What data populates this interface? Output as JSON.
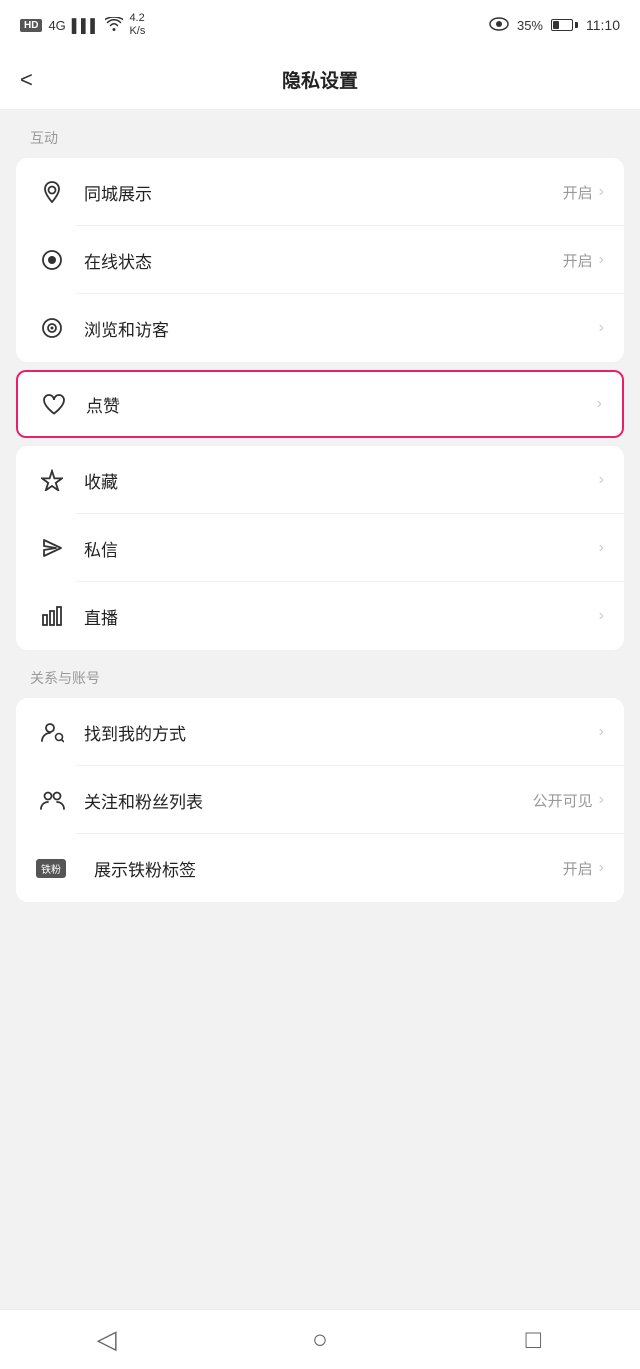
{
  "statusBar": {
    "hd": "HD",
    "signal": "4G",
    "network": "4.2\nK/s",
    "battery": "35%",
    "time": "11:10"
  },
  "header": {
    "back": "<",
    "title": "隐私设置"
  },
  "sections": [
    {
      "label": "互动",
      "items": [
        {
          "id": "tongcheng",
          "icon": "📍",
          "iconType": "location",
          "text": "同城展示",
          "value": "开启",
          "chevron": "›",
          "highlight": false
        },
        {
          "id": "online",
          "icon": "◉",
          "iconType": "online",
          "text": "在线状态",
          "value": "开启",
          "chevron": "›",
          "highlight": false
        },
        {
          "id": "browse",
          "icon": "👁",
          "iconType": "eye",
          "text": "浏览和访客",
          "value": "",
          "chevron": "›",
          "highlight": false
        },
        {
          "id": "like",
          "icon": "♡",
          "iconType": "heart",
          "text": "点赞",
          "value": "",
          "chevron": "›",
          "highlight": true
        },
        {
          "id": "collect",
          "icon": "☆",
          "iconType": "star",
          "text": "收藏",
          "value": "",
          "chevron": "›",
          "highlight": false
        },
        {
          "id": "message",
          "icon": "◁",
          "iconType": "send",
          "text": "私信",
          "value": "",
          "chevron": "›",
          "highlight": false
        },
        {
          "id": "live",
          "icon": "📊",
          "iconType": "bar",
          "text": "直播",
          "value": "",
          "chevron": "›",
          "highlight": false
        }
      ]
    },
    {
      "label": "关系与账号",
      "items": [
        {
          "id": "findme",
          "icon": "👤",
          "iconType": "person-search",
          "text": "找到我的方式",
          "value": "",
          "chevron": "›",
          "highlight": false
        },
        {
          "id": "followfans",
          "icon": "👥",
          "iconType": "persons",
          "text": "关注和粉丝列表",
          "value": "公开可见",
          "chevron": "›",
          "highlight": false
        },
        {
          "id": "ironfan",
          "icon": "铁粉",
          "iconType": "ironfan-badge",
          "text": "展示铁粉标签",
          "value": "开启",
          "chevron": "›",
          "highlight": false
        }
      ]
    }
  ],
  "bottomNav": {
    "back": "◁",
    "home": "○",
    "recent": "□"
  }
}
